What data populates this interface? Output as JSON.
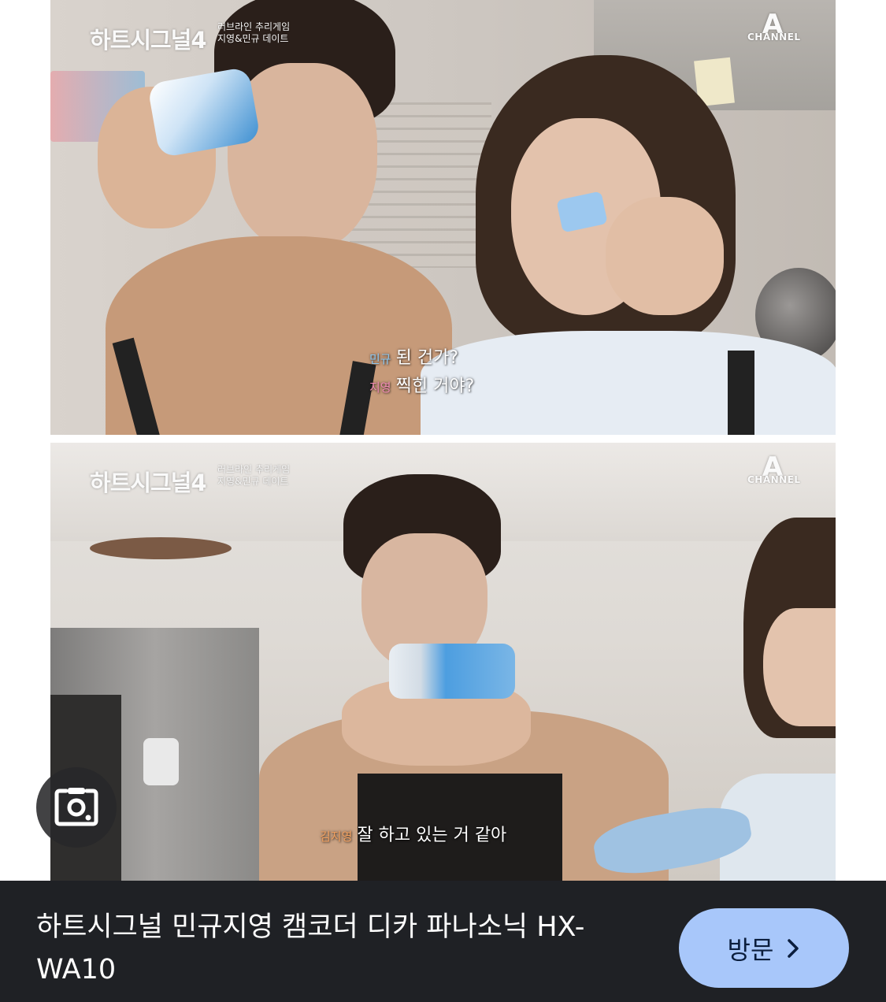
{
  "frames": [
    {
      "show_logo": "하트시그널4",
      "show_subtitle_lines": [
        "러브라인 추리게임",
        "지영&민규 데이트"
      ],
      "channel_logo": {
        "mark": "A",
        "word": "CHANNEL"
      },
      "captions": [
        {
          "speaker": "민규",
          "text": "된 건가?"
        },
        {
          "speaker": "지영",
          "text": "찍힌 거야?"
        }
      ]
    },
    {
      "show_logo": "하트시그널4",
      "show_subtitle_lines": [
        "러브라인 추리게임",
        "지영&민규 데이트"
      ],
      "channel_logo": {
        "mark": "A",
        "word": "CHANNEL"
      },
      "captions": [
        {
          "speaker": "김지영",
          "text": "잘 하고 있는 거 같아"
        }
      ]
    }
  ],
  "lens_button": {
    "icon": "google-lens-icon"
  },
  "result": {
    "title": "하트시그널 민규지영 캠코더 디카 파나소닉 HX-WA10",
    "visit_label": "방문",
    "visit_icon": "chevron-right-icon"
  },
  "colors": {
    "result_bar": "#1f2125",
    "visit_button": "#a8c7fa",
    "speaker_blue": "#8ec8f0",
    "speaker_pink": "#f08ab4",
    "speaker_orange": "#f0a060"
  }
}
